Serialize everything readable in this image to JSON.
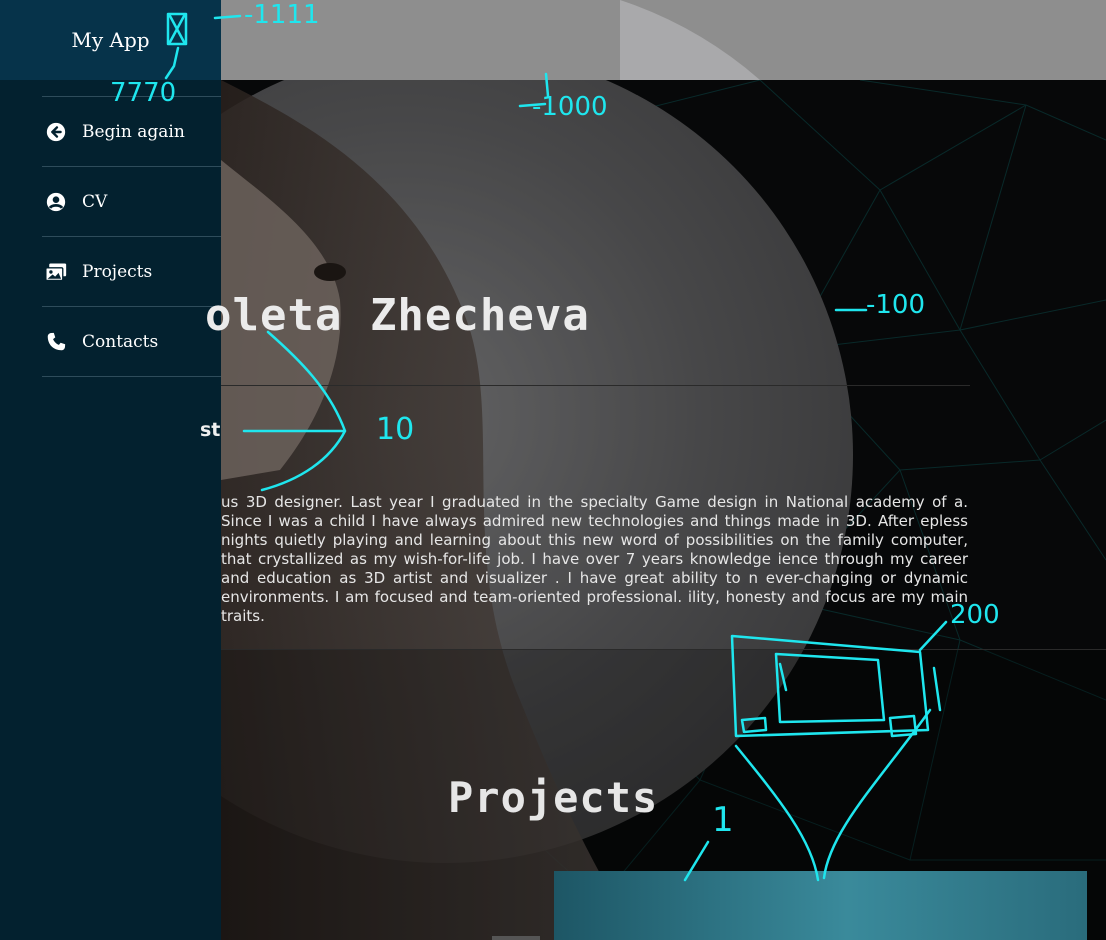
{
  "app": {
    "brand": "My App"
  },
  "sidebar": {
    "items": [
      {
        "label": "Begin again",
        "icon": "arrow-left-circle-icon"
      },
      {
        "label": "CV",
        "icon": "user-circle-icon"
      },
      {
        "label": "Projects",
        "icon": "images-icon"
      },
      {
        "label": "Contacts",
        "icon": "phone-icon"
      }
    ]
  },
  "hero": {
    "name": "oleta Zhecheva",
    "role": "st",
    "bio": "us 3D designer. Last year I graduated in the specialty Game design in National academy of a. Since I was a child I have always admired new technologies and things made in 3D. After epless nights quietly playing and learning about this new word of possibilities on the family computer, that crystallized as my wish-for-life job. I have over 7 years knowledge ience through my career and education as 3D artist and visualizer . I have great ability to n ever-changing or dynamic environments. I am focused and team-oriented professional. ility, honesty and focus are my main traits."
  },
  "projects": {
    "title": "Projects"
  },
  "annotations": {
    "a1": "-1111",
    "a2": "-1000",
    "a3": "-100",
    "a4": "10",
    "a5": "200",
    "a6": "1",
    "a7": "7770"
  },
  "colors": {
    "sidebar": "#03212f",
    "brand_bg": "#06334a",
    "annotation": "#1fe6ee",
    "accent_card": "#3a8a9b"
  }
}
